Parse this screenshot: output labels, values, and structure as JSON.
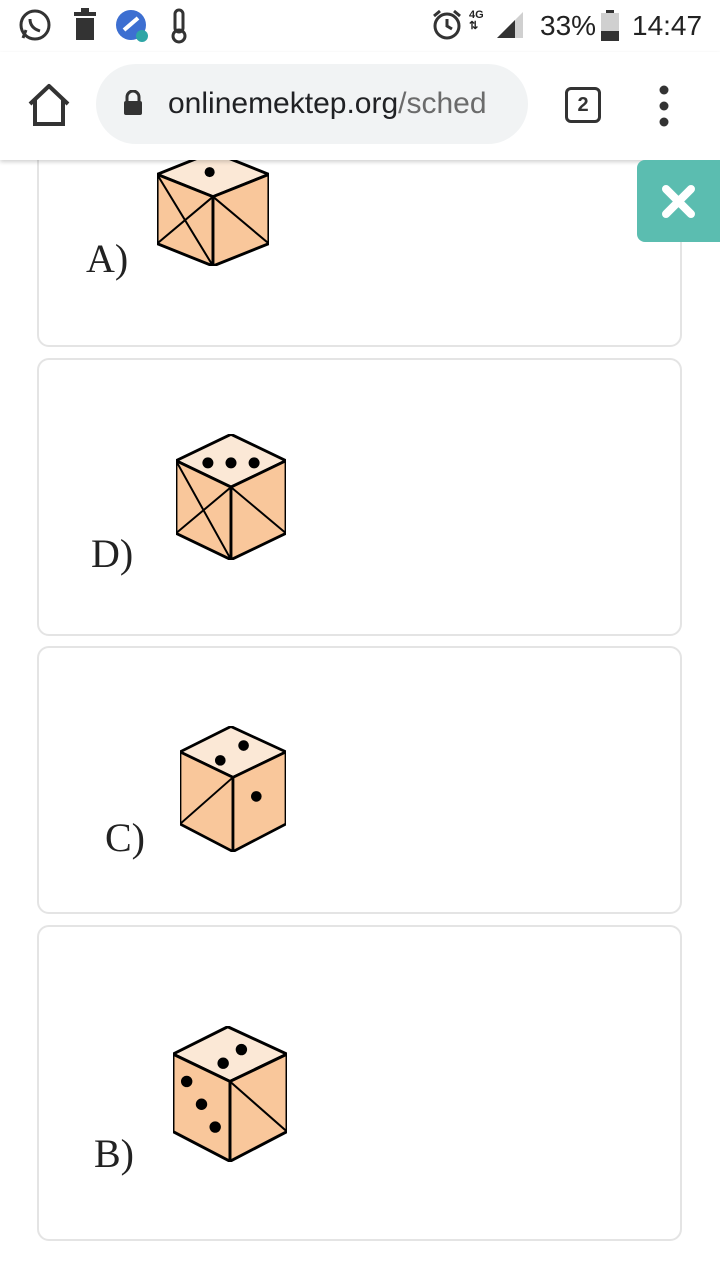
{
  "status_bar": {
    "time": "14:47",
    "battery": "33%",
    "network": "4G",
    "icons": [
      "whatsapp-icon",
      "trash-icon",
      "cleaner-app-icon",
      "thermometer-icon",
      "alarm-icon",
      "network-4g-icon",
      "signal-icon",
      "battery-icon"
    ]
  },
  "browser": {
    "url_host": "onlinemektep.org",
    "url_path": "/sched",
    "tab_count": "2",
    "icons": [
      "home-icon",
      "lock-icon",
      "more-vert-icon"
    ]
  },
  "close_button": {
    "icon": "close-icon",
    "color": "#5bbdb0"
  },
  "options": [
    {
      "label": "A)",
      "top_pips": 1,
      "left_face": "x",
      "right_face": "x"
    },
    {
      "label": "D)",
      "top_pips": 3,
      "left_face": "x",
      "right_face": "diagonal"
    },
    {
      "label": "C)",
      "top_pips": 2,
      "left_face": "diagonal",
      "right_face": "one-pip"
    },
    {
      "label": "B)",
      "top_pips": 2,
      "left_face": "three-pips",
      "right_face": "diagonal"
    }
  ],
  "colors": {
    "die_top": "#fbe8d6",
    "die_side": "#f9c79b",
    "accent": "#5bbdb0"
  }
}
